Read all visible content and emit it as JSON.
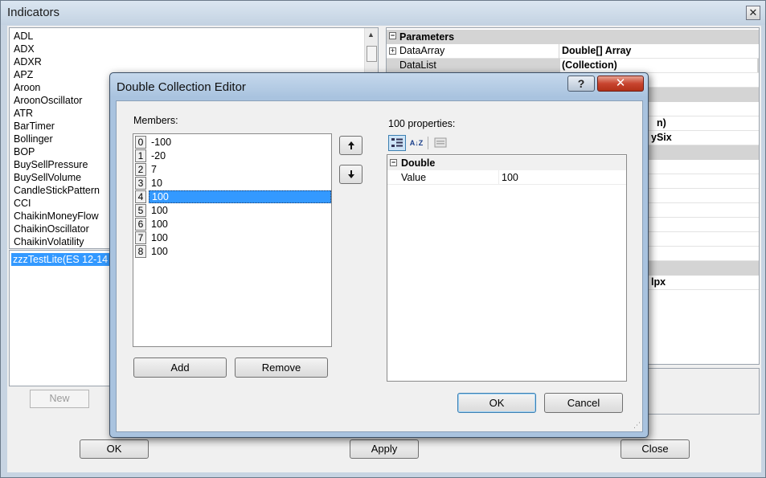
{
  "indicators_window": {
    "title": "Indicators",
    "close_glyph": "✕",
    "indicator_list": [
      "ADL",
      "ADX",
      "ADXR",
      "APZ",
      "Aroon",
      "AroonOscillator",
      "ATR",
      "BarTimer",
      "Bollinger",
      "BOP",
      "BuySellPressure",
      "BuySellVolume",
      "CandleStickPattern",
      "CCI",
      "ChaikinMoneyFlow",
      "ChaikinOscillator",
      "ChaikinVolatility"
    ],
    "applied_indicator": "zzzTestLite(ES 12-14",
    "new_label": "New",
    "ok_label": "OK",
    "apply_label": "Apply",
    "close_label": "Close",
    "property_grid": {
      "category": "Parameters",
      "rows": [
        {
          "name": "DataArray",
          "value": "Double[] Array"
        },
        {
          "name": "DataList",
          "value": "(Collection)"
        }
      ],
      "partial_values": [
        "n)",
        "ySix",
        "lpx"
      ]
    }
  },
  "collection_editor": {
    "title": "Double Collection Editor",
    "help_glyph": "?",
    "close_glyph": "✕",
    "members_label": "Members:",
    "members": [
      {
        "index": "0",
        "value": "-100"
      },
      {
        "index": "1",
        "value": "-20"
      },
      {
        "index": "2",
        "value": "7"
      },
      {
        "index": "3",
        "value": "10"
      },
      {
        "index": "4",
        "value": "100"
      },
      {
        "index": "5",
        "value": "100"
      },
      {
        "index": "6",
        "value": "100"
      },
      {
        "index": "7",
        "value": "100"
      },
      {
        "index": "8",
        "value": "100"
      }
    ],
    "selected_index": 4,
    "move_up_glyph": "🡅",
    "move_down_glyph": "🡇",
    "add_label": "Add",
    "remove_label": "Remove",
    "properties_label": "100 properties:",
    "toolbar": {
      "categorized_icon": "categorized-icon",
      "alphabetical_icon": "sort-az-icon",
      "property_pages_icon": "property-pages-icon",
      "sort_glyph": "A↓Z"
    },
    "property_category": "Double",
    "property_row": {
      "name": "Value",
      "value": "100"
    },
    "ok_label": "OK",
    "cancel_label": "Cancel"
  }
}
